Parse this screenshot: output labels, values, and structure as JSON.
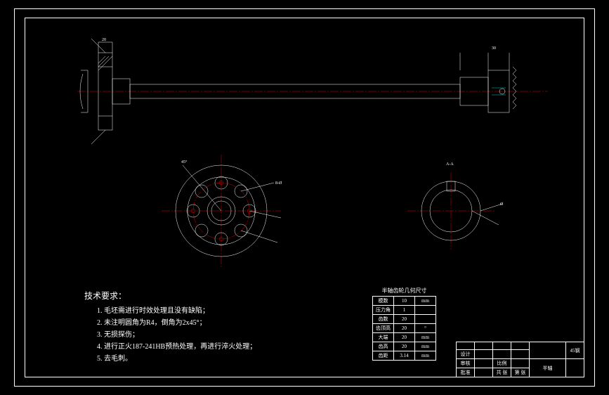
{
  "tech_requirements": {
    "heading": "技术要求：",
    "items": [
      "毛坯需进行时效处理且没有缺陷；",
      "未注明圆角为R4，倒角为2x45°；",
      "无损探伤；",
      "进行正火187-241HB预热处理，再进行淬火处理；",
      "去毛刺。"
    ]
  },
  "param_table": {
    "caption": "半轴齿轮几何尺寸",
    "rows": [
      [
        "模数",
        "10",
        "mm"
      ],
      [
        "压力角",
        "1",
        ""
      ],
      [
        "齿数",
        "20",
        ""
      ],
      [
        "齿顶高",
        "20",
        "°"
      ],
      [
        "大端",
        "20",
        "mm"
      ],
      [
        "齿高",
        "20",
        "mm"
      ],
      [
        "齿距",
        "3.14",
        "mm"
      ]
    ]
  },
  "title_block": {
    "material_label": "45钢",
    "part_name": "半轴",
    "scale_label": "比例",
    "qty_label": "共 张",
    "sheet_label": "第 张",
    "design_label": "设计",
    "check_label": "审核",
    "approve_label": "批准"
  },
  "views": {
    "section_label": "A-A"
  }
}
